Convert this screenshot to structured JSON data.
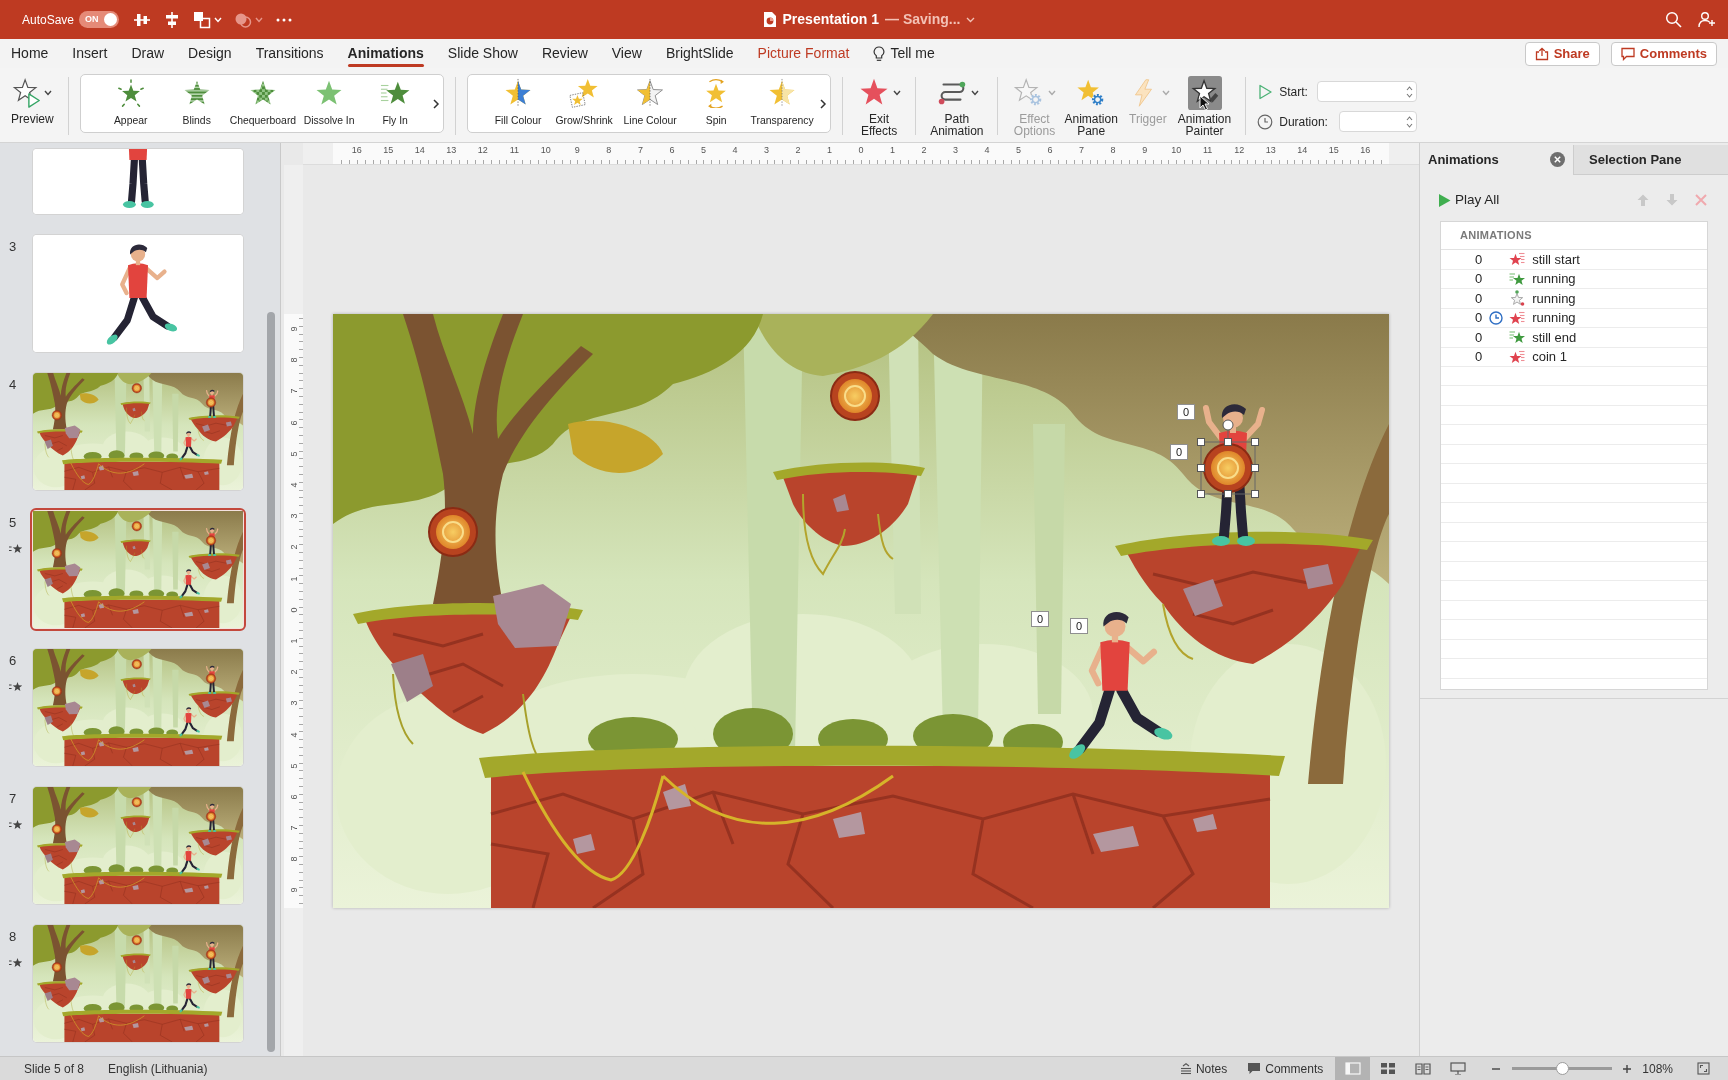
{
  "title_bar": {
    "autosave_label": "AutoSave",
    "autosave": {
      "on": true,
      "text": "ON"
    },
    "quick_access": [
      {
        "kind": "align",
        "dropdown": false,
        "disabled": false
      },
      {
        "kind": "distribute",
        "dropdown": false,
        "disabled": false
      },
      {
        "kind": "arrange",
        "dropdown": true,
        "disabled": false
      },
      {
        "kind": "shapes",
        "dropdown": true,
        "disabled": true
      },
      {
        "kind": "more",
        "dropdown": false,
        "disabled": false
      }
    ],
    "document_title": "Presentation 1",
    "save_status": "— Saving..."
  },
  "menu_tabs": [
    {
      "label": "Home",
      "kind": "tab",
      "selected": false
    },
    {
      "label": "Insert",
      "kind": "tab",
      "selected": false
    },
    {
      "label": "Draw",
      "kind": "tab",
      "selected": false
    },
    {
      "label": "Design",
      "kind": "tab",
      "selected": false
    },
    {
      "label": "Transitions",
      "kind": "tab",
      "selected": false
    },
    {
      "label": "Animations",
      "kind": "tab",
      "selected": true
    },
    {
      "label": "Slide Show",
      "kind": "tab",
      "selected": false
    },
    {
      "label": "Review",
      "kind": "tab",
      "selected": false
    },
    {
      "label": "View",
      "kind": "tab",
      "selected": false
    },
    {
      "label": "BrightSlide",
      "kind": "tab",
      "selected": false
    },
    {
      "label": "Picture Format",
      "kind": "contextual",
      "selected": false
    },
    {
      "label": "Tell me",
      "kind": "search",
      "selected": false
    }
  ],
  "header_buttons": [
    {
      "label": "Share",
      "kind": "share"
    },
    {
      "label": "Comments",
      "kind": "comments"
    }
  ],
  "ribbon": {
    "preview": {
      "label": "Preview",
      "dropdown": true
    },
    "galleries": [
      {
        "effects": [
          {
            "label": "Appear",
            "kind": "appear"
          },
          {
            "label": "Blinds",
            "kind": "blinds"
          },
          {
            "label": "Chequerboard",
            "kind": "chequerboard"
          },
          {
            "label": "Dissolve In",
            "kind": "dissolve_in"
          },
          {
            "label": "Fly In",
            "kind": "fly_in"
          }
        ]
      },
      {
        "effects": [
          {
            "label": "Fill Colour",
            "kind": "fill_colour"
          },
          {
            "label": "Grow/Shrink",
            "kind": "grow_shrink"
          },
          {
            "label": "Line Colour",
            "kind": "line_colour"
          },
          {
            "label": "Spin",
            "kind": "spin"
          },
          {
            "label": "Transparency",
            "kind": "transparency"
          }
        ]
      }
    ],
    "command_groups": [
      [
        {
          "label": "Exit Effects",
          "kind": "exit",
          "dropdown": true,
          "disabled": false,
          "pressed": false
        }
      ],
      [
        {
          "label": "Path Animation",
          "kind": "path",
          "dropdown": true,
          "disabled": false,
          "pressed": false
        }
      ],
      [
        {
          "label": "Effect Options",
          "kind": "effect_options",
          "dropdown": true,
          "disabled": true,
          "pressed": false
        },
        {
          "label": "Animation Pane",
          "kind": "animation_pane",
          "dropdown": false,
          "disabled": false,
          "pressed": false
        },
        {
          "label": "Trigger",
          "kind": "trigger",
          "dropdown": true,
          "disabled": true,
          "pressed": false
        },
        {
          "label": "Animation Painter",
          "kind": "painter",
          "dropdown": false,
          "disabled": false,
          "pressed": true
        }
      ]
    ],
    "timing": [
      {
        "label": "Start:",
        "kind": "start"
      },
      {
        "label": "Duration:",
        "kind": "duration"
      }
    ]
  },
  "slides": [
    {
      "kind": "standing",
      "selected": false,
      "animated": false
    },
    {
      "number": "3",
      "kind": "running",
      "selected": false,
      "animated": false
    },
    {
      "number": "4",
      "kind": "scene",
      "selected": false,
      "animated": false
    },
    {
      "number": "5",
      "kind": "scene",
      "selected": true,
      "animated": true
    },
    {
      "number": "6",
      "kind": "scene",
      "selected": false,
      "animated": true
    },
    {
      "number": "7",
      "kind": "scene",
      "selected": false,
      "animated": true
    },
    {
      "number": "8",
      "kind": "scene",
      "selected": false,
      "animated": true
    }
  ],
  "rulers": {
    "horizontal": [
      "16",
      "15",
      "14",
      "13",
      "12",
      "11",
      "10",
      "9",
      "8",
      "7",
      "6",
      "5",
      "4",
      "3",
      "2",
      "1",
      "0",
      "1",
      "2",
      "3",
      "4",
      "5",
      "6",
      "7",
      "8",
      "9",
      "10",
      "11",
      "12",
      "13",
      "14",
      "15",
      "16"
    ],
    "vertical": [
      "9",
      "8",
      "7",
      "6",
      "5",
      "4",
      "3",
      "2",
      "1",
      "0",
      "1",
      "2",
      "3",
      "4",
      "5",
      "6",
      "7",
      "8",
      "9"
    ]
  },
  "slide": {
    "coins": [
      {
        "selected": false
      },
      {
        "selected": false
      },
      {
        "selected": true
      }
    ],
    "animation_tags": [
      "0",
      "0",
      "0",
      "0"
    ]
  },
  "animation_pane": {
    "tabs": [
      {
        "label": "Animations",
        "selected": true,
        "closable": true
      },
      {
        "label": "Selection Pane",
        "selected": false,
        "closable": false
      }
    ],
    "play_all": "Play All",
    "tools": [
      {
        "kind": "move_up",
        "disabled": true
      },
      {
        "kind": "move_down",
        "disabled": true
      },
      {
        "kind": "remove",
        "disabled": true
      }
    ],
    "list_header": "ANIMATIONS",
    "items": [
      {
        "order": "0",
        "kind": "exit",
        "delayed": false,
        "name": "still start"
      },
      {
        "order": "0",
        "kind": "entrance",
        "delayed": false,
        "name": "running"
      },
      {
        "order": "0",
        "kind": "path",
        "delayed": false,
        "name": "running"
      },
      {
        "order": "0",
        "kind": "exit",
        "delayed": true,
        "name": "running"
      },
      {
        "order": "0",
        "kind": "entrance",
        "delayed": false,
        "name": "still end"
      },
      {
        "order": "0",
        "kind": "exit",
        "delayed": false,
        "name": "coin 1"
      }
    ]
  },
  "status_bar": {
    "slide_info": "Slide 5 of 8",
    "language": "English (Lithuania)",
    "buttons": [
      {
        "label": "Notes",
        "kind": "notes"
      },
      {
        "label": "Comments",
        "kind": "comments"
      }
    ],
    "views": [
      {
        "kind": "normal",
        "selected": true
      },
      {
        "kind": "sorter",
        "selected": false
      },
      {
        "kind": "reading",
        "selected": false
      },
      {
        "kind": "slideshow",
        "selected": false
      }
    ],
    "zoom": {
      "level": 0.51,
      "reading": "108%"
    }
  }
}
